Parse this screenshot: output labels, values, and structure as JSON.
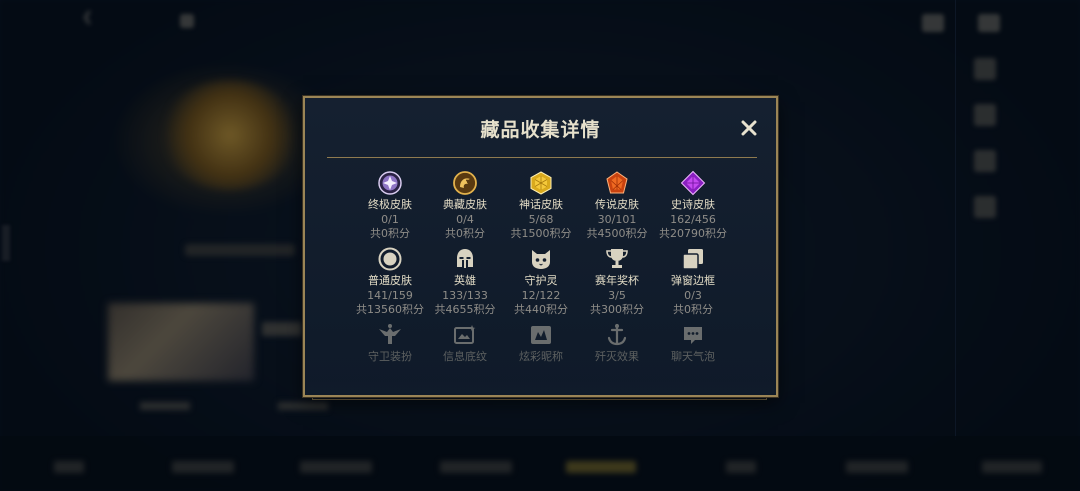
{
  "modal": {
    "title": "藏品收集详情",
    "close_icon": "close-icon"
  },
  "items": [
    {
      "name": "终极皮肤",
      "count": "0/1",
      "points": "共0积分",
      "icon": "ultimate-skin-gem-icon",
      "color": "#b39ad6"
    },
    {
      "name": "典藏皮肤",
      "count": "0/4",
      "points": "共0积分",
      "icon": "collection-skin-dragon-icon",
      "color": "#c8932e"
    },
    {
      "name": "神话皮肤",
      "count": "5/68",
      "points": "共1500积分",
      "icon": "mythic-skin-gem-icon",
      "color": "#d9a91c"
    },
    {
      "name": "传说皮肤",
      "count": "30/101",
      "points": "共4500积分",
      "icon": "legendary-skin-gem-icon",
      "color": "#e05a1c"
    },
    {
      "name": "史诗皮肤",
      "count": "162/456",
      "points": "共20790积分",
      "icon": "epic-skin-gem-icon",
      "color": "#a32bd6"
    },
    {
      "name": "普通皮肤",
      "count": "141/159",
      "points": "共13560积分",
      "icon": "normal-skin-ring-icon",
      "color": "#c9c3b0"
    },
    {
      "name": "英雄",
      "count": "133/133",
      "points": "共4655积分",
      "icon": "hero-helmet-icon",
      "color": "#d8d2c0"
    },
    {
      "name": "守护灵",
      "count": "12/122",
      "points": "共440积分",
      "icon": "guardian-spirit-icon",
      "color": "#d8d2c0"
    },
    {
      "name": "赛年奖杯",
      "count": "3/5",
      "points": "共300积分",
      "icon": "season-trophy-icon",
      "color": "#d8d2c0"
    },
    {
      "name": "弹窗边框",
      "count": "0/3",
      "points": "共0积分",
      "icon": "popup-frame-icon",
      "color": "#d8d2c0"
    },
    {
      "name": "守卫装扮",
      "icon": "guard-outfit-icon",
      "color": "#d8d2c0"
    },
    {
      "name": "信息底纹",
      "icon": "info-background-icon",
      "color": "#d8d2c0"
    },
    {
      "name": "炫彩昵称",
      "icon": "colorful-nickname-icon",
      "color": "#d8d2c0"
    },
    {
      "name": "歼灭效果",
      "icon": "kill-effect-icon",
      "color": "#d8d2c0"
    },
    {
      "name": "聊天气泡",
      "icon": "chat-bubble-icon",
      "color": "#d8d2c0"
    }
  ],
  "colors": {
    "modal_border": "#9b8556",
    "modal_bg": "#152030",
    "title": "#e6e0cb",
    "secondary_text": "#8f8d88"
  }
}
